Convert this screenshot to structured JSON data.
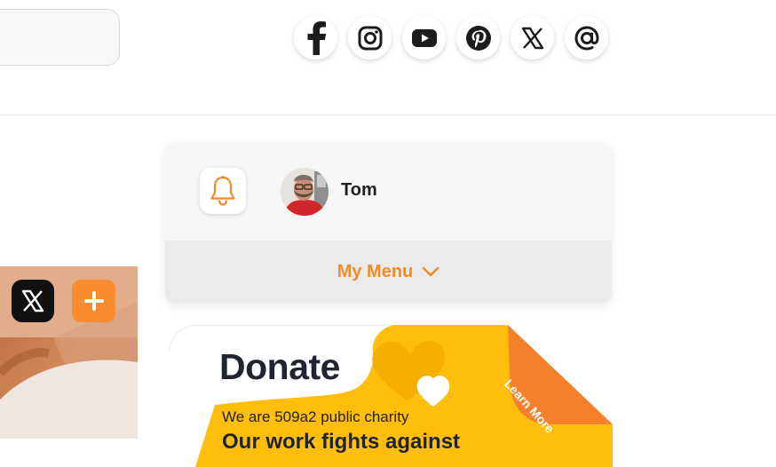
{
  "search": {
    "value": ""
  },
  "social": {
    "items": [
      {
        "name": "facebook",
        "icon": "facebook-icon"
      },
      {
        "name": "instagram",
        "icon": "instagram-icon"
      },
      {
        "name": "youtube",
        "icon": "youtube-icon"
      },
      {
        "name": "pinterest",
        "icon": "pinterest-icon"
      },
      {
        "name": "x",
        "icon": "x-icon"
      },
      {
        "name": "threads",
        "icon": "at-icon"
      }
    ]
  },
  "user_card": {
    "bell_icon": "bell-icon",
    "user_name": "Tom",
    "menu_label": "My Menu",
    "menu_icon": "chevron-down-icon"
  },
  "share_strip": {
    "x_icon": "x-icon",
    "plus_icon": "plus-icon"
  },
  "donate": {
    "title": "Donate",
    "subtitle": "We are 509a2 public charity",
    "line2": "Our work fights against",
    "learn_more": "Learn More",
    "heart_icon": "heart-icon"
  },
  "colors": {
    "accent_orange": "#f28c28",
    "donate_yellow": "#ffbe0b",
    "dark_text": "#1f2430"
  }
}
